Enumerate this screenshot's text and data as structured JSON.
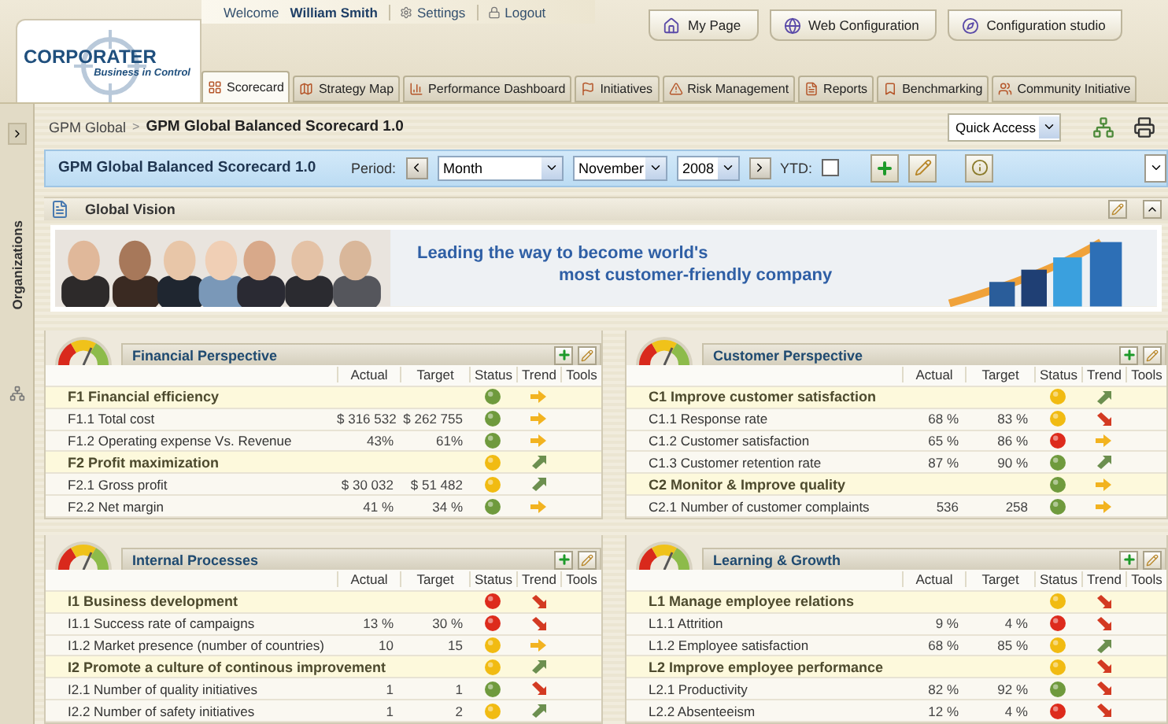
{
  "logo": {
    "name": "CORPORATER",
    "tagline": "Business in Control"
  },
  "user_bar": {
    "welcome": "Welcome",
    "user": "William Smith",
    "links": [
      "Settings",
      "Logout"
    ]
  },
  "top_buttons": [
    "My Page",
    "Web Configuration",
    "Configuration studio"
  ],
  "tabs": [
    {
      "label": "Scorecard",
      "selected": true
    },
    {
      "label": "Strategy Map",
      "selected": false
    },
    {
      "label": "Performance Dashboard",
      "selected": false
    },
    {
      "label": "Initiatives",
      "selected": false
    },
    {
      "label": "Risk Management",
      "selected": false
    },
    {
      "label": "Reports",
      "selected": false
    },
    {
      "label": "Benchmarking",
      "selected": false
    },
    {
      "label": "Community Initiative",
      "selected": false
    }
  ],
  "sidebar": {
    "label": "Organizations"
  },
  "breadcrumb": {
    "parent": "GPM Global",
    "separator": ">",
    "current": "GPM Global Balanced Scorecard 1.0"
  },
  "quick_access": "Quick Access",
  "scorecard_bar": {
    "title": "GPM Global Balanced Scorecard 1.0",
    "period_label": "Period:",
    "period": "Month",
    "month": "November",
    "year": "2008",
    "ytd_label": "YTD:",
    "ytd_checked": false
  },
  "vision": {
    "title": "Global Vision",
    "line1": "Leading the way to become world's",
    "line2": "most customer-friendly company"
  },
  "panels": [
    {
      "title": "Financial Perspective",
      "columns": [
        "Actual",
        "Target",
        "Status",
        "Trend",
        "Tools"
      ],
      "rows": [
        {
          "kind": "group",
          "name": "F1 Financial efficiency",
          "status": {
            "color": "#6f9a3d"
          },
          "trend": {
            "kind": "flat"
          }
        },
        {
          "kind": "item",
          "name": "F1.1 Total cost",
          "actual": "$ 316 532",
          "target": "$ 262 755",
          "status": {
            "color": "#6f9a3d"
          },
          "trend": {
            "kind": "flat"
          }
        },
        {
          "kind": "item",
          "name": "F1.2 Operating expense Vs. Revenue",
          "actual": "43%",
          "target": "61%",
          "status": {
            "color": "#6f9a3d"
          },
          "trend": {
            "kind": "flat"
          }
        },
        {
          "kind": "group",
          "name": "F2 Profit maximization",
          "status": {
            "color": "#f1bb12"
          },
          "trend": {
            "kind": "up"
          }
        },
        {
          "kind": "item",
          "name": "F2.1 Gross profit",
          "actual": "$ 30 032",
          "target": "$ 51 482",
          "status": {
            "color": "#f1bb12"
          },
          "trend": {
            "kind": "up"
          }
        },
        {
          "kind": "item",
          "name": "F2.2 Net margin",
          "actual": "41 %",
          "target": "34 %",
          "status": {
            "color": "#6f9a3d"
          },
          "trend": {
            "kind": "flat"
          }
        }
      ]
    },
    {
      "title": "Customer Perspective",
      "columns": [
        "Actual",
        "Target",
        "Status",
        "Trend",
        "Tools"
      ],
      "rows": [
        {
          "kind": "group",
          "name": "C1 Improve customer satisfaction",
          "status": {
            "color": "#f1bb12"
          },
          "trend": {
            "kind": "up"
          }
        },
        {
          "kind": "item",
          "name": "C1.1 Response rate",
          "actual": "68 %",
          "target": "83 %",
          "status": {
            "color": "#f1bb12"
          },
          "trend": {
            "kind": "down"
          }
        },
        {
          "kind": "item",
          "name": "C1.2 Customer satisfaction",
          "actual": "65 %",
          "target": "86 %",
          "status": {
            "color": "#dd2b1c"
          },
          "trend": {
            "kind": "flat"
          }
        },
        {
          "kind": "item",
          "name": "C1.3 Customer retention rate",
          "actual": "87 %",
          "target": "90 %",
          "status": {
            "color": "#6f9a3d"
          },
          "trend": {
            "kind": "up"
          }
        },
        {
          "kind": "group",
          "name": "C2 Monitor & Improve quality",
          "status": {
            "color": "#6f9a3d"
          },
          "trend": {
            "kind": "flat"
          }
        },
        {
          "kind": "item",
          "name": "C2.1 Number of customer complaints",
          "actual": "536",
          "target": "258",
          "status": {
            "color": "#6f9a3d"
          },
          "trend": {
            "kind": "flat"
          }
        }
      ]
    },
    {
      "title": "Internal Processes",
      "columns": [
        "Actual",
        "Target",
        "Status",
        "Trend",
        "Tools"
      ],
      "rows": [
        {
          "kind": "group",
          "name": "I1 Business development",
          "status": {
            "color": "#dd2b1c"
          },
          "trend": {
            "kind": "down"
          }
        },
        {
          "kind": "item",
          "name": "I1.1 Success rate of campaigns",
          "actual": "13 %",
          "target": "30 %",
          "status": {
            "color": "#dd2b1c"
          },
          "trend": {
            "kind": "down"
          }
        },
        {
          "kind": "item",
          "name": "I1.2 Market presence (number of countries)",
          "actual": "10",
          "target": "15",
          "status": {
            "color": "#f1bb12"
          },
          "trend": {
            "kind": "flat"
          }
        },
        {
          "kind": "group",
          "name": "I2 Promote a culture of continous improvement",
          "status": {
            "color": "#f1bb12"
          },
          "trend": {
            "kind": "up"
          }
        },
        {
          "kind": "item",
          "name": "I2.1 Number of quality initiatives",
          "actual": "1",
          "target": "1",
          "status": {
            "color": "#6f9a3d"
          },
          "trend": {
            "kind": "down"
          }
        },
        {
          "kind": "item",
          "name": "I2.2 Number of safety initiatives",
          "actual": "1",
          "target": "2",
          "status": {
            "color": "#f1bb12"
          },
          "trend": {
            "kind": "up"
          }
        }
      ]
    },
    {
      "title": "Learning & Growth",
      "columns": [
        "Actual",
        "Target",
        "Status",
        "Trend",
        "Tools"
      ],
      "rows": [
        {
          "kind": "group",
          "name": "L1 Manage employee relations",
          "status": {
            "color": "#f1bb12"
          },
          "trend": {
            "kind": "down"
          }
        },
        {
          "kind": "item",
          "name": "L1.1 Attrition",
          "actual": "9 %",
          "target": "4 %",
          "status": {
            "color": "#dd2b1c"
          },
          "trend": {
            "kind": "down"
          }
        },
        {
          "kind": "item",
          "name": "L1.2 Employee satisfaction",
          "actual": "68 %",
          "target": "85 %",
          "status": {
            "color": "#f1bb12"
          },
          "trend": {
            "kind": "up"
          }
        },
        {
          "kind": "group",
          "name": "L2 Improve employee performance",
          "status": {
            "color": "#f1bb12"
          },
          "trend": {
            "kind": "down"
          }
        },
        {
          "kind": "item",
          "name": "L2.1 Productivity",
          "actual": "82 %",
          "target": "92 %",
          "status": {
            "color": "#6f9a3d"
          },
          "trend": {
            "kind": "down"
          }
        },
        {
          "kind": "item",
          "name": "L2.2 Absenteeism",
          "actual": "12 %",
          "target": "4 %",
          "status": {
            "color": "#dd2b1c"
          },
          "trend": {
            "kind": "down"
          }
        }
      ]
    }
  ]
}
